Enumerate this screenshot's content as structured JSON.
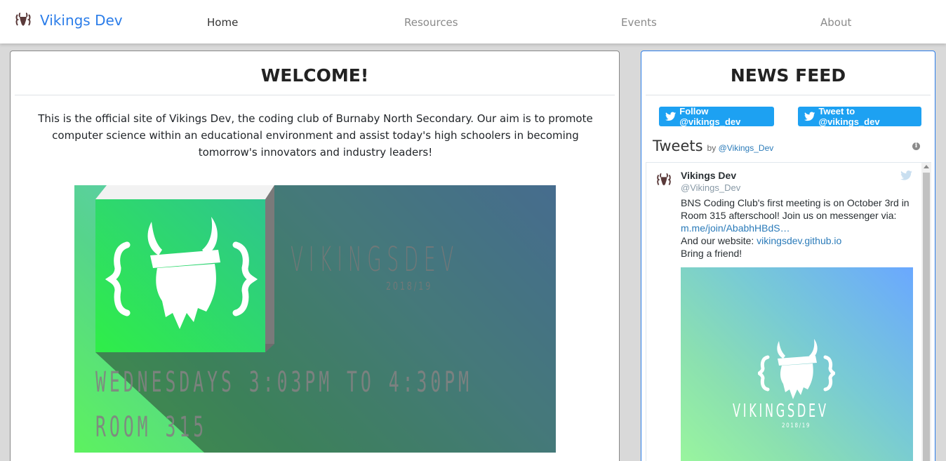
{
  "navbar": {
    "brand": "Vikings Dev",
    "links": [
      {
        "label": "Home",
        "active": true
      },
      {
        "label": "Resources",
        "active": false
      },
      {
        "label": "Events",
        "active": false
      },
      {
        "label": "About",
        "active": false
      }
    ]
  },
  "welcome": {
    "title": "WELCOME!",
    "text": "This is the official site of Vikings Dev, the coding club of Burnaby North Secondary. Our aim is to promote computer science within an educational environment and assist today's high schoolers in becoming tomorrow's innovators and industry leaders!",
    "banner": {
      "title": "VIKINGSDEV",
      "year": "2018/19",
      "time": "WEDNESDAYS 3:03PM TO 4:30PM",
      "room": "ROOM 315"
    }
  },
  "news": {
    "title": "NEWS FEED",
    "follow_label": "Follow @vikings_dev",
    "tweet_label": "Tweet to @vikings_dev",
    "tweets_title": "Tweets",
    "tweets_by": "by",
    "tweets_handle": "@Vikings_Dev",
    "info": "i",
    "tweet": {
      "name": "Vikings Dev",
      "handle": "@Vikings_Dev",
      "line1": "BNS Coding Club's first meeting is on October 3rd in Room 315 afterschool! Join us on messenger via:",
      "link1": "m.me/join/AbabhHBdS…",
      "line2_prefix": "And our website: ",
      "link2": "vikingsdev.github.io",
      "line3": "Bring a friend!",
      "media_title": "VIKINGSDEV",
      "media_year": "2018/19"
    }
  },
  "colors": {
    "brand": "#2b7de9",
    "twitter": "#1da1f2",
    "link": "#2b7bb9"
  },
  "icons": [
    "viking-logo-icon",
    "twitter-bird-icon",
    "info-icon"
  ]
}
